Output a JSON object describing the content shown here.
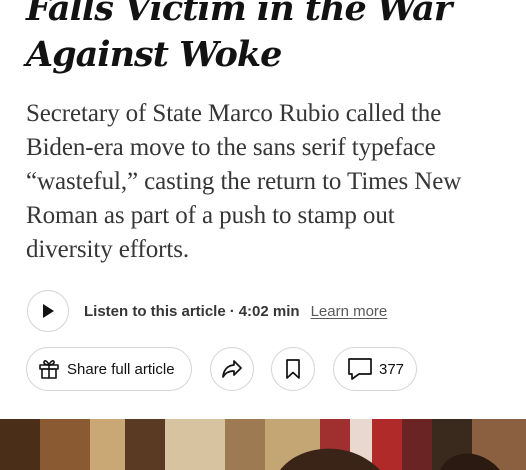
{
  "article": {
    "headline_lines": [
      "Falls Victim in the War",
      "Against Woke"
    ],
    "summary_lines": [
      "Secretary of State Marco Rubio called the",
      "Biden-era move to the sans serif typeface",
      "“wasteful,” casting the return to Times New",
      "Roman as part of a push to stamp out",
      "diversity efforts."
    ]
  },
  "audio": {
    "play_icon": "play-icon",
    "listen_label": "Listen to this article",
    "separator": "·",
    "duration": "4:02 min",
    "learn_more": "Learn more"
  },
  "actions": {
    "share_icon": "gift-icon",
    "share_label": "Share full article",
    "forward_icon": "share-arrow-icon",
    "save_icon": "bookmark-icon",
    "comments_icon": "comment-bubble-icon",
    "comments_count": "377"
  },
  "colors": {
    "text": "#121212",
    "summary_text": "#363636",
    "border": "#d4d4d4"
  }
}
